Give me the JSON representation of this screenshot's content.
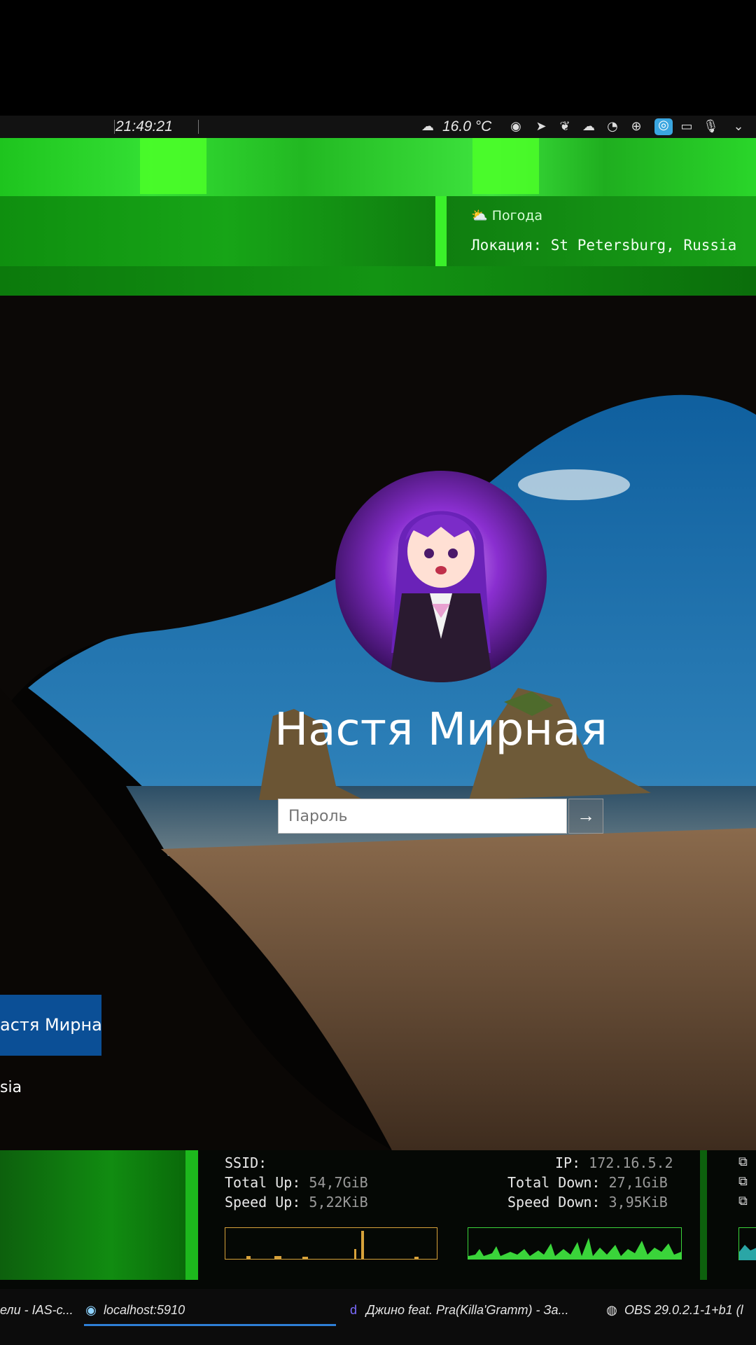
{
  "top_bar": {
    "clock": "21:49:21",
    "temperature": "16.0 °C",
    "tray_icons": [
      "weather-icon",
      "discord-icon",
      "telegram-icon",
      "leaf-icon",
      "cloud-icon",
      "steam-icon",
      "network-icon",
      "app-icon",
      "terminal-icon",
      "microphone-icon",
      "chevron-down-icon"
    ]
  },
  "weather_widget": {
    "title": "Погода",
    "location": "Локация: St Petersburg, Russia"
  },
  "login": {
    "username": "Настя Мирная",
    "password_placeholder": "Пароль",
    "submit_arrow": "→",
    "user_tile_label": "астя Мирная",
    "network_label": "sia"
  },
  "network_panel": {
    "ssid_label": "SSID:",
    "ip_label": "IP:",
    "ip_value": "172.16.5.2",
    "total_up_label": "Total Up:",
    "total_up_value": "54,7GiB",
    "total_down_label": "Total Down:",
    "total_down_value": "27,1GiB",
    "speed_up_label": "Speed Up:",
    "speed_up_value": "5,22KiB",
    "speed_down_label": "Speed Down:",
    "speed_down_value": "3,95KiB"
  },
  "taskbar": {
    "items": [
      {
        "label": "ели - IAS-c..."
      },
      {
        "label": "localhost:5910"
      },
      {
        "label": "Джино feat. Pra(Killa'Gramm) - За..."
      },
      {
        "label": "OBS 29.0.2.1-1+b1 (l"
      }
    ]
  },
  "colors": {
    "accent_green": "#2ad62a",
    "tile_blue": "#0b4f96",
    "graph_up": "#d7a23a",
    "graph_down": "#3ad43a"
  }
}
